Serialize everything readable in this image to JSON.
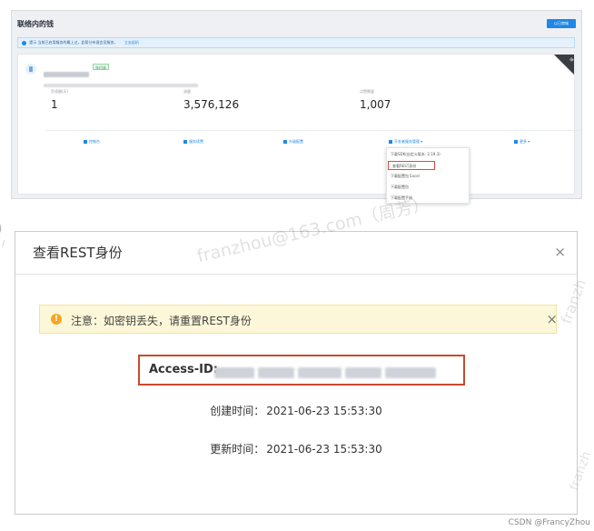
{
  "top_panel": {
    "title": "联络内的钱",
    "button_label": "以已商城",
    "notice_text": "提示 当前已启用服务的最上过，此帮分布速会员服务，",
    "notice_link": "立去起机",
    "card": {
      "corner_label": "拼",
      "tag": "年付本",
      "stats": [
        {
          "label": "负续缴(天)",
          "value": "1"
        },
        {
          "label": "流量",
          "value": "3,576,126"
        },
        {
          "label": "点赞数量",
          "value": "1,007"
        }
      ],
      "actions": [
        {
          "label": "控制台"
        },
        {
          "label": "服务续费"
        },
        {
          "label": "升级配置"
        },
        {
          "label": "开发者服务管理"
        },
        {
          "label": "更多"
        }
      ],
      "dropdown_items": [
        {
          "label": "下载SDK(自定义版本: 2.19.3)"
        },
        {
          "label": "查看REST身份"
        },
        {
          "label": "下载配置包 Excel"
        },
        {
          "label": "下载配置包"
        },
        {
          "label": "下载配置手册"
        }
      ]
    }
  },
  "dialog": {
    "title": "查看REST身份",
    "close_icon": "×",
    "warning": {
      "icon": "!",
      "text": "注意：如密钥丢失，请重置REST身份",
      "close_icon": "×"
    },
    "access_id_label": "Access-ID:",
    "created_label": "创建时间：",
    "created_value": "2021-06-23 15:53:30",
    "updated_label": "更新时间：",
    "updated_value": "2021-06-23 15:53:30"
  },
  "watermark": "franzhou@163.com（周芳）",
  "watermark_edge": "franzh",
  "credit": "CSDN @FrancyZhou",
  "colors": {
    "accent": "#1f87e6",
    "highlight_border": "#c74a2b",
    "warning_bg": "#fdf7d9",
    "warning_icon": "#f5a623"
  }
}
